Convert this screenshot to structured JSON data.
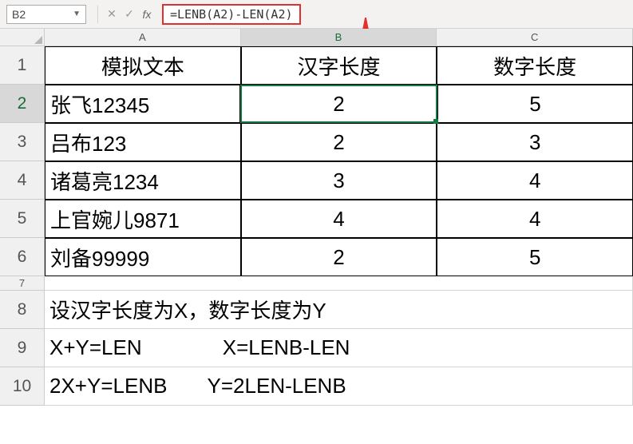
{
  "formula_bar": {
    "cell_ref": "B2",
    "formula": "=LENB(A2)-LEN(A2)"
  },
  "columns": [
    "A",
    "B",
    "C"
  ],
  "rows": [
    {
      "n": "1",
      "a": "模拟文本",
      "b": "汉字长度",
      "c": "数字长度",
      "bordered": true,
      "center": true
    },
    {
      "n": "2",
      "a": "张飞12345",
      "b": "2",
      "c": "5",
      "bordered": true,
      "bcenter": true,
      "selrow": true,
      "selcell": "b"
    },
    {
      "n": "3",
      "a": "吕布123",
      "b": "2",
      "c": "3",
      "bordered": true,
      "bcenter": true
    },
    {
      "n": "4",
      "a": "诸葛亮1234",
      "b": "3",
      "c": "4",
      "bordered": true,
      "bcenter": true
    },
    {
      "n": "5",
      "a": "上官婉儿9871",
      "b": "4",
      "c": "4",
      "bordered": true,
      "bcenter": true
    },
    {
      "n": "6",
      "a": "刘备99999",
      "b": "2",
      "c": "5",
      "bordered": true,
      "bcenter": true
    }
  ],
  "note_rows": [
    {
      "n": "7",
      "text": "",
      "short": true
    },
    {
      "n": "8",
      "text": "设汉字长度为X，数字长度为Y"
    },
    {
      "n": "9",
      "text": "X+Y=LEN              X=LENB-LEN"
    },
    {
      "n": "10",
      "text": "2X+Y=LENB       Y=2LEN-LENB"
    }
  ],
  "annotation_color": "#e03030"
}
